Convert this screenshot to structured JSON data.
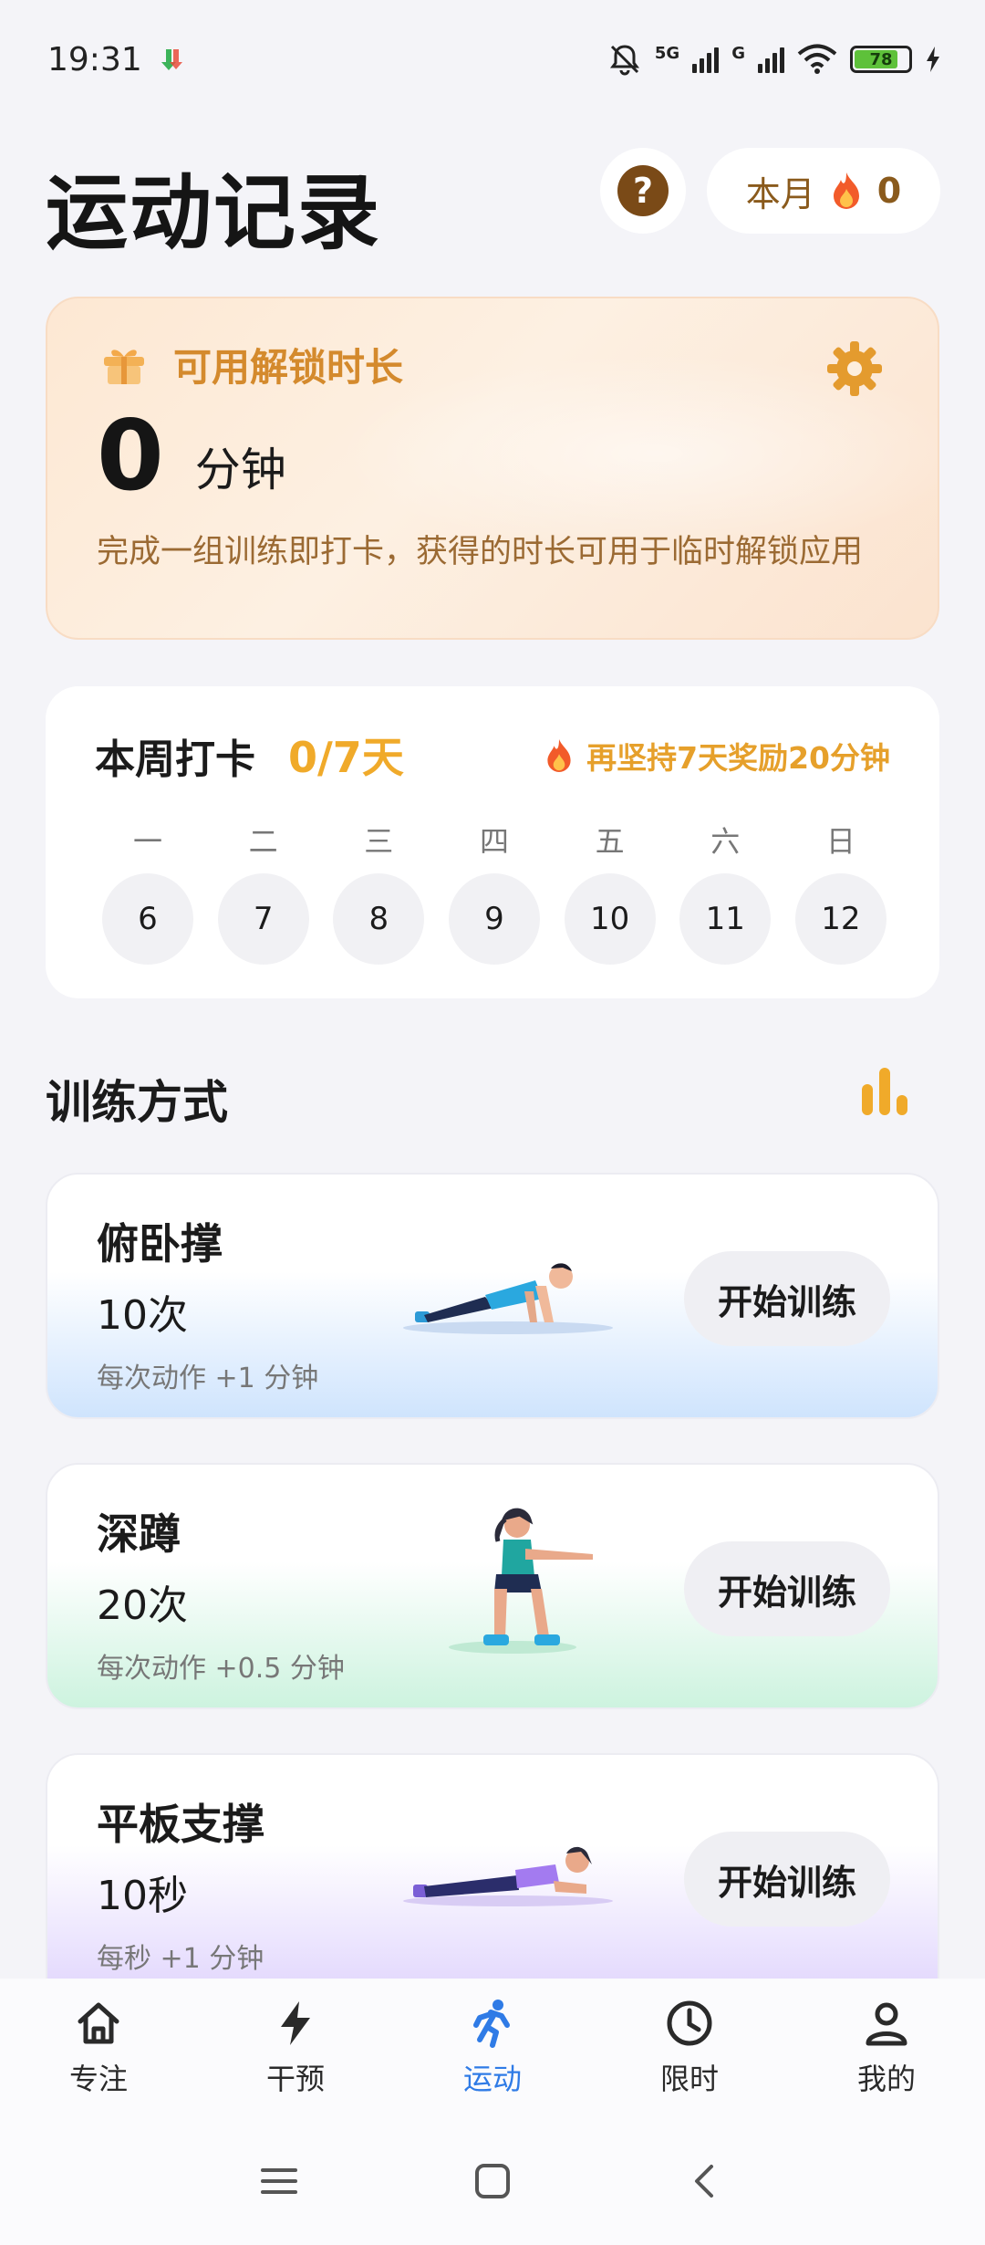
{
  "status_bar": {
    "time": "19:31",
    "battery": "78",
    "network_1": "5G",
    "network_2": "G"
  },
  "header": {
    "title": "运动记录",
    "help_icon": "?",
    "month_label": "本月",
    "month_count": "0"
  },
  "unlock_card": {
    "title": "可用解锁时长",
    "value": "0",
    "unit": "分钟",
    "description": "完成一组训练即打卡，获得的时长可用于临时解锁应用"
  },
  "week_card": {
    "title": "本周打卡",
    "count": "0/7天",
    "bonus": "再坚持7天奖励20分钟",
    "weekdays": [
      "一",
      "二",
      "三",
      "四",
      "五",
      "六",
      "日"
    ],
    "dates": [
      "6",
      "7",
      "8",
      "9",
      "10",
      "11",
      "12"
    ]
  },
  "training": {
    "section_title": "训练方式",
    "items": [
      {
        "name": "俯卧撑",
        "reps": "10次",
        "reward": "每次动作 +1 分钟",
        "button": "开始训练"
      },
      {
        "name": "深蹲",
        "reps": "20次",
        "reward": "每次动作 +0.5 分钟",
        "button": "开始训练"
      },
      {
        "name": "平板支撑",
        "reps": "10秒",
        "reward": "每秒 +1 分钟",
        "button": "开始训练"
      }
    ]
  },
  "bottom_nav": {
    "items": [
      {
        "label": "专注",
        "icon": "home-icon"
      },
      {
        "label": "干预",
        "icon": "bolt-icon"
      },
      {
        "label": "运动",
        "icon": "running-icon"
      },
      {
        "label": "限时",
        "icon": "clock-icon"
      },
      {
        "label": "我的",
        "icon": "person-icon"
      }
    ],
    "active_index": 2
  },
  "colors": {
    "accent": "#2f7be6",
    "orange": "#f0aa2a",
    "brown": "#7a4a17"
  }
}
